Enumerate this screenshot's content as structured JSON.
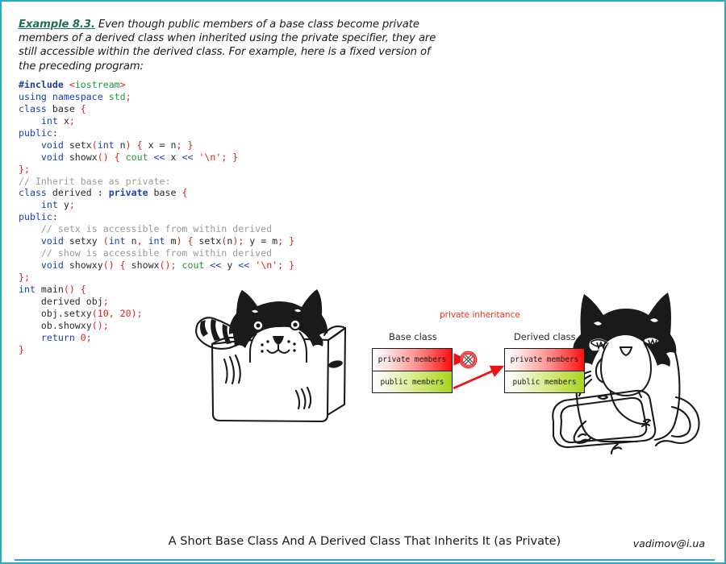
{
  "page": {
    "border_color": "#2aa8c4",
    "background": "#ffffff"
  },
  "intro": {
    "example_label": "Example 8.3.",
    "body": " Even though public members of a base class become private members of a derived class when inherited using the private specifier, they are still accessible within the derived class. For example, here is a fixed version of the preceding program:"
  },
  "code": {
    "language": "cpp",
    "lines": [
      [
        {
          "t": "#include ",
          "c": "pp"
        },
        {
          "t": "<",
          "c": "r"
        },
        {
          "t": "iostream",
          "c": "s"
        },
        {
          "t": ">",
          "c": "r"
        }
      ],
      [
        {
          "t": "using namespace ",
          "c": "k"
        },
        {
          "t": "std",
          "c": "s"
        },
        {
          "t": ";",
          "c": "r"
        }
      ],
      [
        {
          "t": "class ",
          "c": "k"
        },
        {
          "t": "base ",
          "c": "t"
        },
        {
          "t": "{",
          "c": "r"
        }
      ],
      [
        {
          "t": "    ",
          "c": "t"
        },
        {
          "t": "int ",
          "c": "k"
        },
        {
          "t": "x",
          "c": "t"
        },
        {
          "t": ";",
          "c": "r"
        }
      ],
      [
        {
          "t": "public",
          "c": "k"
        },
        {
          "t": ":",
          "c": "t"
        }
      ],
      [
        {
          "t": "    ",
          "c": "t"
        },
        {
          "t": "void ",
          "c": "k"
        },
        {
          "t": "setx",
          "c": "t"
        },
        {
          "t": "(",
          "c": "r"
        },
        {
          "t": "int ",
          "c": "k"
        },
        {
          "t": "n",
          "c": "t"
        },
        {
          "t": ")",
          "c": "r"
        },
        {
          "t": " ",
          "c": "t"
        },
        {
          "t": "{",
          "c": "r"
        },
        {
          "t": " x = n",
          "c": "t"
        },
        {
          "t": ";",
          "c": "r"
        },
        {
          "t": " ",
          "c": "t"
        },
        {
          "t": "}",
          "c": "r"
        }
      ],
      [
        {
          "t": "    ",
          "c": "t"
        },
        {
          "t": "void ",
          "c": "k"
        },
        {
          "t": "showx",
          "c": "t"
        },
        {
          "t": "()",
          "c": "r"
        },
        {
          "t": " ",
          "c": "t"
        },
        {
          "t": "{",
          "c": "r"
        },
        {
          "t": " ",
          "c": "t"
        },
        {
          "t": "cout",
          "c": "s"
        },
        {
          "t": " << ",
          "c": "k"
        },
        {
          "t": "x",
          "c": "t"
        },
        {
          "t": " << ",
          "c": "k"
        },
        {
          "t": "'\\n'",
          "c": "r"
        },
        {
          "t": ";",
          "c": "r"
        },
        {
          "t": " ",
          "c": "t"
        },
        {
          "t": "}",
          "c": "r"
        }
      ],
      [
        {
          "t": "}",
          "c": "r"
        },
        {
          "t": ";",
          "c": "r"
        }
      ],
      [
        {
          "t": "// Inherit base as private:",
          "c": "c"
        }
      ],
      [
        {
          "t": "class ",
          "c": "k"
        },
        {
          "t": "derived : ",
          "c": "t"
        },
        {
          "t": "private ",
          "c": "kb"
        },
        {
          "t": "base ",
          "c": "t"
        },
        {
          "t": "{",
          "c": "r"
        }
      ],
      [
        {
          "t": "    ",
          "c": "t"
        },
        {
          "t": "int ",
          "c": "k"
        },
        {
          "t": "y",
          "c": "t"
        },
        {
          "t": ";",
          "c": "r"
        }
      ],
      [
        {
          "t": "public",
          "c": "k"
        },
        {
          "t": ":",
          "c": "t"
        }
      ],
      [
        {
          "t": "    ",
          "c": "t"
        },
        {
          "t": "// setx is accessible from within derived",
          "c": "c"
        }
      ],
      [
        {
          "t": "    ",
          "c": "t"
        },
        {
          "t": "void ",
          "c": "k"
        },
        {
          "t": "setxy ",
          "c": "t"
        },
        {
          "t": "(",
          "c": "r"
        },
        {
          "t": "int ",
          "c": "k"
        },
        {
          "t": "n",
          "c": "t"
        },
        {
          "t": ", ",
          "c": "r"
        },
        {
          "t": "int ",
          "c": "k"
        },
        {
          "t": "m",
          "c": "t"
        },
        {
          "t": ")",
          "c": "r"
        },
        {
          "t": " ",
          "c": "t"
        },
        {
          "t": "{",
          "c": "r"
        },
        {
          "t": " setx",
          "c": "t"
        },
        {
          "t": "(",
          "c": "r"
        },
        {
          "t": "n",
          "c": "t"
        },
        {
          "t": ")",
          "c": "r"
        },
        {
          "t": ";",
          "c": "r"
        },
        {
          "t": " y = m",
          "c": "t"
        },
        {
          "t": ";",
          "c": "r"
        },
        {
          "t": " ",
          "c": "t"
        },
        {
          "t": "}",
          "c": "r"
        }
      ],
      [
        {
          "t": "    ",
          "c": "t"
        },
        {
          "t": "// show is accessible from within derived",
          "c": "c"
        }
      ],
      [
        {
          "t": "    ",
          "c": "t"
        },
        {
          "t": "void ",
          "c": "k"
        },
        {
          "t": "showxy",
          "c": "t"
        },
        {
          "t": "()",
          "c": "r"
        },
        {
          "t": " ",
          "c": "t"
        },
        {
          "t": "{",
          "c": "r"
        },
        {
          "t": " showx",
          "c": "t"
        },
        {
          "t": "()",
          "c": "r"
        },
        {
          "t": ";",
          "c": "r"
        },
        {
          "t": " ",
          "c": "t"
        },
        {
          "t": "cout",
          "c": "s"
        },
        {
          "t": " << ",
          "c": "k"
        },
        {
          "t": "y",
          "c": "t"
        },
        {
          "t": " << ",
          "c": "k"
        },
        {
          "t": "'\\n'",
          "c": "r"
        },
        {
          "t": ";",
          "c": "r"
        },
        {
          "t": " ",
          "c": "t"
        },
        {
          "t": "}",
          "c": "r"
        }
      ],
      [
        {
          "t": "}",
          "c": "r"
        },
        {
          "t": ";",
          "c": "r"
        }
      ],
      [
        {
          "t": "int ",
          "c": "k"
        },
        {
          "t": "main",
          "c": "t"
        },
        {
          "t": "()",
          "c": "r"
        },
        {
          "t": " ",
          "c": "t"
        },
        {
          "t": "{",
          "c": "r"
        }
      ],
      [
        {
          "t": "    derived obj",
          "c": "t"
        },
        {
          "t": ";",
          "c": "r"
        }
      ],
      [
        {
          "t": "    obj.setxy",
          "c": "t"
        },
        {
          "t": "(",
          "c": "r"
        },
        {
          "t": "10",
          "c": "r"
        },
        {
          "t": ", ",
          "c": "r"
        },
        {
          "t": "20",
          "c": "r"
        },
        {
          "t": ")",
          "c": "r"
        },
        {
          "t": ";",
          "c": "r"
        }
      ],
      [
        {
          "t": "    ob.showxy",
          "c": "t"
        },
        {
          "t": "()",
          "c": "r"
        },
        {
          "t": ";",
          "c": "r"
        }
      ],
      [
        {
          "t": "    ",
          "c": "t"
        },
        {
          "t": "return ",
          "c": "k"
        },
        {
          "t": "0",
          "c": "r"
        },
        {
          "t": ";",
          "c": "r"
        }
      ],
      [
        {
          "t": "}",
          "c": "r"
        }
      ]
    ]
  },
  "diagram": {
    "relation_label": "private inheritance",
    "relation_label_color": "#f2321f",
    "base": {
      "caption": "Base class",
      "rows": [
        {
          "label": "private members",
          "kind": "private",
          "color": "#fb0f0f"
        },
        {
          "label": "public members",
          "kind": "public",
          "color": "#a7d41b"
        }
      ]
    },
    "derived": {
      "caption": "Derived class",
      "rows": [
        {
          "label": "private members",
          "kind": "private",
          "color": "#fb0f0f"
        },
        {
          "label": "public members",
          "kind": "public",
          "color": "#a7d41b"
        }
      ]
    },
    "blocked_marker": {
      "name": "no-entry-icon",
      "color": "#ee2222"
    },
    "arrows": [
      {
        "from": "base.private",
        "to": "blocked-marker",
        "color": "#ee1111",
        "blocked": true
      },
      {
        "from": "base.public",
        "to": "derived.private",
        "color": "#ee1111",
        "blocked": false
      }
    ]
  },
  "illustrations": [
    {
      "name": "cat-in-box-drawing",
      "alt": "Line-art cat peeking out of a cardboard box"
    },
    {
      "name": "sitting-cat-with-laptop-drawing",
      "alt": "Line-art cat sitting with a laptop and striped tail"
    }
  ],
  "footer": {
    "title": "A Short Base Class And A Derived Class That Inherits It (as Private)",
    "credit": "vadimov@i.ua",
    "rule_color": "#2aa8c4"
  }
}
